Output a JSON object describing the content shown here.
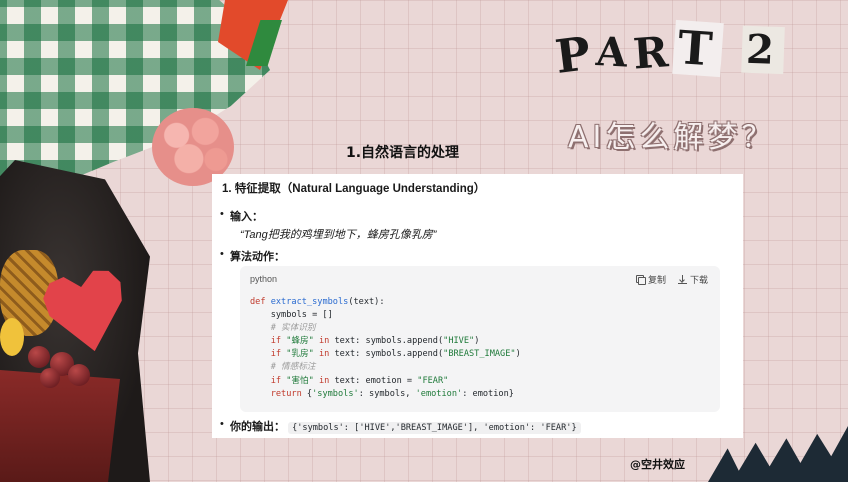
{
  "header": {
    "part_letters": [
      "P",
      "A",
      "R",
      "T"
    ],
    "part_number": "2",
    "subtitle": "AI怎么解梦？",
    "section_title": "1.自然语言的处理"
  },
  "card": {
    "heading": "1. 特征提取（Natural Language Understanding）",
    "input_label": "输入：",
    "input_quote": "“Tang把我的鸡埋到地下，蜂房孔像乳房”",
    "algo_label": "算法动作：",
    "code_block": {
      "language": "python",
      "copy_label": "复制",
      "download_label": "下载",
      "copy_icon": "copy-icon",
      "download_icon": "download-icon",
      "lines": [
        [
          {
            "t": "def ",
            "c": "kw"
          },
          {
            "t": "extract_symbols",
            "c": "fn"
          },
          {
            "t": "(text):",
            "c": ""
          }
        ],
        [
          {
            "t": "    symbols = []",
            "c": ""
          }
        ],
        [
          {
            "t": "    # 实体识别",
            "c": "cm"
          }
        ],
        [
          {
            "t": "    ",
            "c": ""
          },
          {
            "t": "if ",
            "c": "kw"
          },
          {
            "t": "\"蜂房\"",
            "c": "st"
          },
          {
            "t": " in ",
            "c": "kw"
          },
          {
            "t": "text: symbols.append(",
            "c": ""
          },
          {
            "t": "\"HIVE\"",
            "c": "st"
          },
          {
            "t": ")",
            "c": ""
          }
        ],
        [
          {
            "t": "    ",
            "c": ""
          },
          {
            "t": "if ",
            "c": "kw"
          },
          {
            "t": "\"乳房\"",
            "c": "st"
          },
          {
            "t": " in ",
            "c": "kw"
          },
          {
            "t": "text: symbols.append(",
            "c": ""
          },
          {
            "t": "\"BREAST_IMAGE\"",
            "c": "st"
          },
          {
            "t": ")",
            "c": ""
          }
        ],
        [
          {
            "t": "    # 情感标注",
            "c": "cm"
          }
        ],
        [
          {
            "t": "    ",
            "c": ""
          },
          {
            "t": "if ",
            "c": "kw"
          },
          {
            "t": "\"害怕\"",
            "c": "st"
          },
          {
            "t": " in ",
            "c": "kw"
          },
          {
            "t": "text: emotion = ",
            "c": ""
          },
          {
            "t": "\"FEAR\"",
            "c": "st"
          }
        ],
        [
          {
            "t": "    ",
            "c": ""
          },
          {
            "t": "return ",
            "c": "kw"
          },
          {
            "t": "{",
            "c": ""
          },
          {
            "t": "'symbols'",
            "c": "st"
          },
          {
            "t": ": symbols, ",
            "c": ""
          },
          {
            "t": "'emotion'",
            "c": "st"
          },
          {
            "t": ": emotion}",
            "c": ""
          }
        ]
      ]
    },
    "output_label": "你的输出：",
    "output_code": "{'symbols': ['HIVE','BREAST_IMAGE'], 'emotion': 'FEAR'}"
  },
  "credit": "@空井效应",
  "colors": {
    "background": "#ead7d6",
    "keyword": "#c0392b",
    "function": "#2a6bd0",
    "string": "#1f7a3a",
    "comment": "#9a9a9a"
  }
}
